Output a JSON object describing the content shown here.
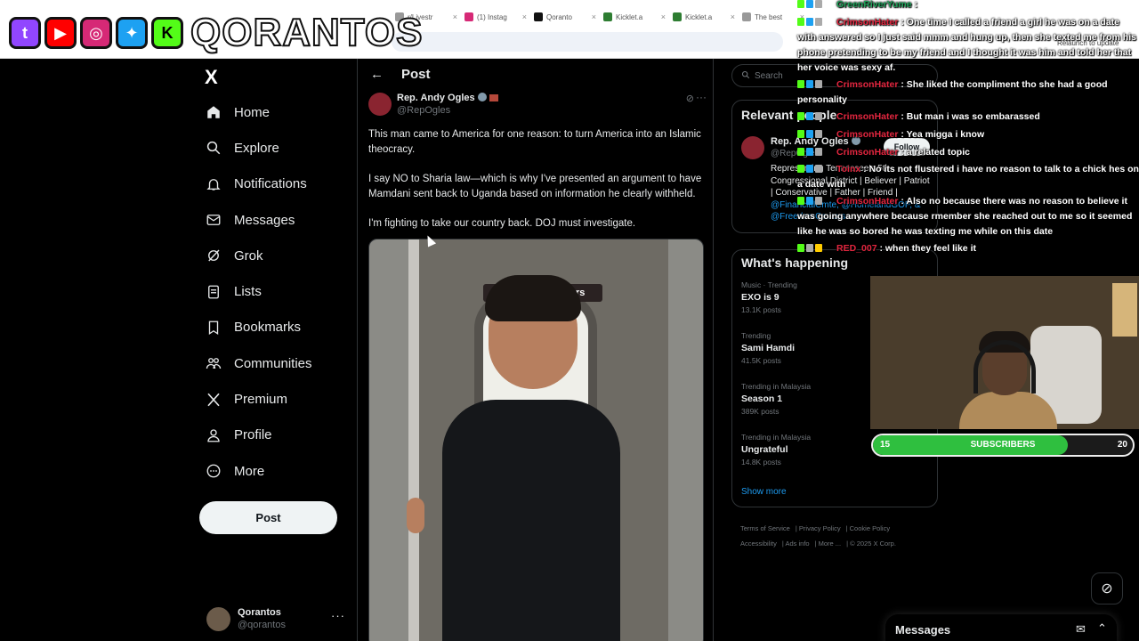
{
  "browser": {
    "tabs": [
      {
        "label": "r/Livestr",
        "icon": "page-icon"
      },
      {
        "label": "(1) Instag",
        "icon": "instagram-icon"
      },
      {
        "label": "Qoranto",
        "icon": "tiktok-icon"
      },
      {
        "label": "Kicklet.a",
        "icon": "kicklet-icon"
      },
      {
        "label": "Kicklet.a",
        "icon": "kicklet-icon"
      },
      {
        "label": "The best",
        "icon": "page-icon"
      }
    ],
    "relaunch": "Relaunch to update"
  },
  "banner": {
    "name": "QORANTOS",
    "socials": [
      "twitch-icon",
      "youtube-icon",
      "instagram-icon",
      "twitter-icon",
      "kick-icon"
    ]
  },
  "sidebar": {
    "logo": "X",
    "items": [
      {
        "label": "Home",
        "icon": "home-icon"
      },
      {
        "label": "Explore",
        "icon": "search-icon"
      },
      {
        "label": "Notifications",
        "icon": "bell-icon"
      },
      {
        "label": "Messages",
        "icon": "mail-icon"
      },
      {
        "label": "Grok",
        "icon": "grok-icon"
      },
      {
        "label": "Lists",
        "icon": "list-icon"
      },
      {
        "label": "Bookmarks",
        "icon": "bookmark-icon"
      },
      {
        "label": "Communities",
        "icon": "communities-icon"
      },
      {
        "label": "Premium",
        "icon": "x-premium-icon"
      },
      {
        "label": "Profile",
        "icon": "person-icon"
      },
      {
        "label": "More",
        "icon": "more-circle-icon"
      }
    ],
    "post_label": "Post",
    "account": {
      "name": "Qorantos",
      "handle": "@qorantos"
    }
  },
  "post": {
    "header_title": "Post",
    "author_name": "Rep. Andy Ogles",
    "author_handle": "@RepOgles",
    "paragraphs": [
      "This man came to America for one reason: to turn America into an Islamic theocracy.",
      "I say NO to Sharia law—which is why I've presented an argument to have Mamdani sent back to Uganda based on information he clearly withheld.",
      "I'm fighting to take our country back. DOJ must investigate."
    ],
    "image_sign": "Do not hold doors"
  },
  "right": {
    "search_placeholder": "Search",
    "relevant": {
      "title": "Relevant people",
      "name": "Rep. Andy Ogles",
      "handle": "@RepOgles",
      "follow_label": "Follow",
      "bio_text": "Representing Tennessee's 5th Congressional District | Believer | Patriot | Conservative | Father | Friend |",
      "bio_mentions": "@FinancialCmte, @HomelandGOP, & @FreedomCaucus"
    },
    "happening_title": "What's happening",
    "trends": [
      {
        "context": "Music · Trending",
        "name": "EXO is 9",
        "posts": "13.1K posts"
      },
      {
        "context": "Trending",
        "name": "Sami Hamdi",
        "posts": "41.5K posts"
      },
      {
        "context": "Trending in Malaysia",
        "name": "Season 1",
        "posts": "389K posts"
      },
      {
        "context": "Trending in Malaysia",
        "name": "Ungrateful",
        "posts": "14.8K posts"
      }
    ],
    "show_more": "Show more",
    "footer": [
      "Terms of Service",
      "Privacy Policy",
      "Cookie Policy",
      "Accessibility",
      "Ads info",
      "More ...",
      "© 2025 X Corp."
    ]
  },
  "chat": {
    "messages": [
      {
        "user": "GreenRiverYume",
        "text": ":"
      },
      {
        "user": "CrimsonHater",
        "text": ": One time I called a friend a girl he was on a date with answered so I just said mmm and hung up, then she texted me from his phone pretending to be my friend and I thought it was him and told her that her voice was sexy af."
      },
      {
        "user": "CrimsonHater",
        "text": ": She liked the compliment tho she had a good personality"
      },
      {
        "user": "CrimsonHater",
        "text": ": But man i was so embarassed"
      },
      {
        "user": "CrimsonHater",
        "text": ": Yea migga i know"
      },
      {
        "user": "CrimsonHater",
        "text": ": a related topic"
      },
      {
        "user": "Toinx",
        "text": ": No its not flustered i have no reason to talk to a chick hes on a date with"
      },
      {
        "user": "CrimsonHater",
        "text": ": Also no because there was no reason to believe it was going anywhere because rmember she reached out to me so it seemed like he was so bored he was texting me while on this date"
      },
      {
        "user": "RED_007",
        "text": ": when they feel like it"
      }
    ]
  },
  "subgoal": {
    "current": "15",
    "label": "SUBSCRIBERS",
    "goal": "20",
    "progress": 0.75
  },
  "messages_drawer": {
    "title": "Messages"
  }
}
